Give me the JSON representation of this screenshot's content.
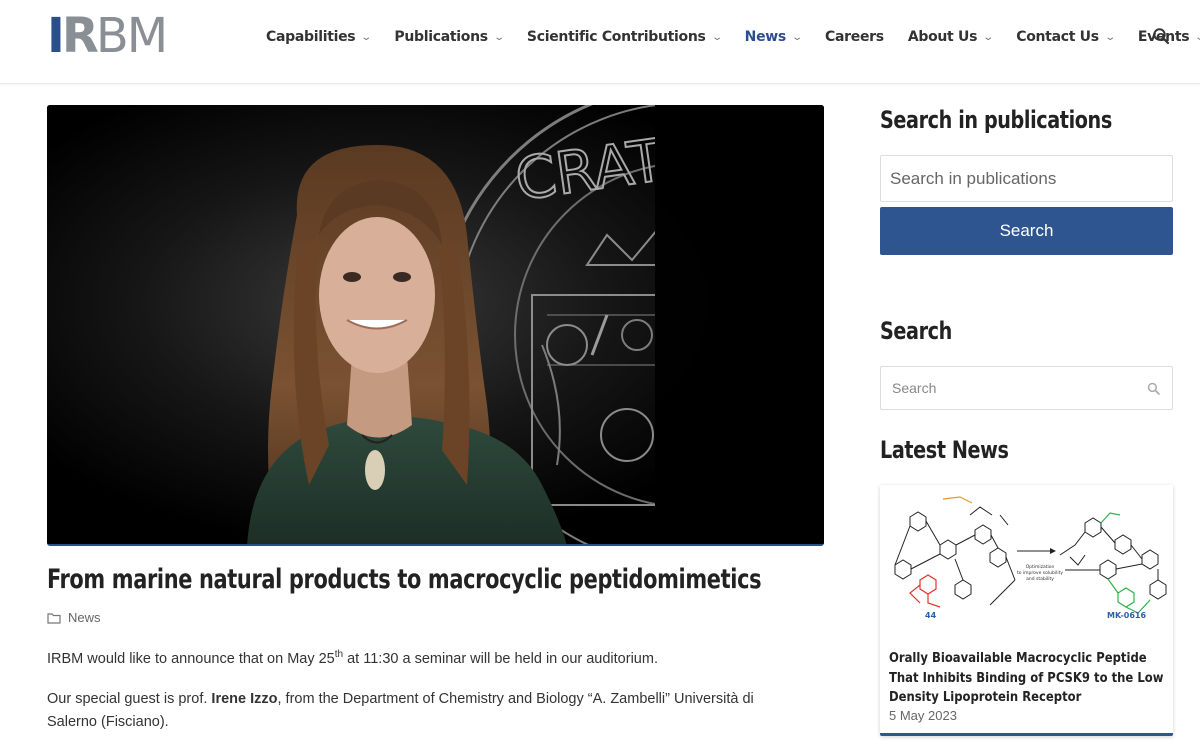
{
  "brand": {
    "logo_bold": "IR",
    "logo_thin": "BM"
  },
  "nav": {
    "items": [
      {
        "label": "Capabilities",
        "dropdown": true
      },
      {
        "label": "Publications",
        "dropdown": true
      },
      {
        "label": "Scientific Contributions",
        "dropdown": true
      },
      {
        "label": "News",
        "dropdown": true,
        "active": true
      },
      {
        "label": "Careers",
        "dropdown": false
      },
      {
        "label": "About Us",
        "dropdown": true
      },
      {
        "label": "Contact Us",
        "dropdown": true
      },
      {
        "label": "Events",
        "dropdown": true
      }
    ],
    "search_icon": "search-icon"
  },
  "hero": {
    "seal_text": "CRATI"
  },
  "article": {
    "title": "From marine natural products to macrocyclic peptidomimetics",
    "category": "News",
    "p1_before": "IRBM would like to announce that on May 25",
    "p1_sup": "th",
    "p1_after": " at 11:30 a seminar will be held in our auditorium.",
    "p2_before": "Our special guest is prof. ",
    "p2_name": "Irene Izzo",
    "p2_after": ", from the Department of Chemistry and Biology “A. Zambelli” Università di Salerno (Fisciano)."
  },
  "sidebar": {
    "pub_heading": "Search in publications",
    "pub_placeholder": "Search in publications",
    "pub_button": "Search",
    "search_heading": "Search",
    "search_placeholder": "Search",
    "latest_heading": "Latest News",
    "latest": {
      "img_label_left": "44",
      "img_label_right": "MK-0616",
      "img_arrow_text_1": "Optimization",
      "img_arrow_text_2": "to improve solubility",
      "img_arrow_text_3": "and stability",
      "title": "Orally Bioavailable Macrocyclic Peptide That Inhibits Binding of PCSK9 to the Low Density Lipoprotein Receptor",
      "date": "5 May 2023"
    }
  },
  "colors": {
    "brand_blue": "#2b4f8c",
    "button_blue": "#2e5590",
    "logo_grey": "#8a8f96"
  }
}
